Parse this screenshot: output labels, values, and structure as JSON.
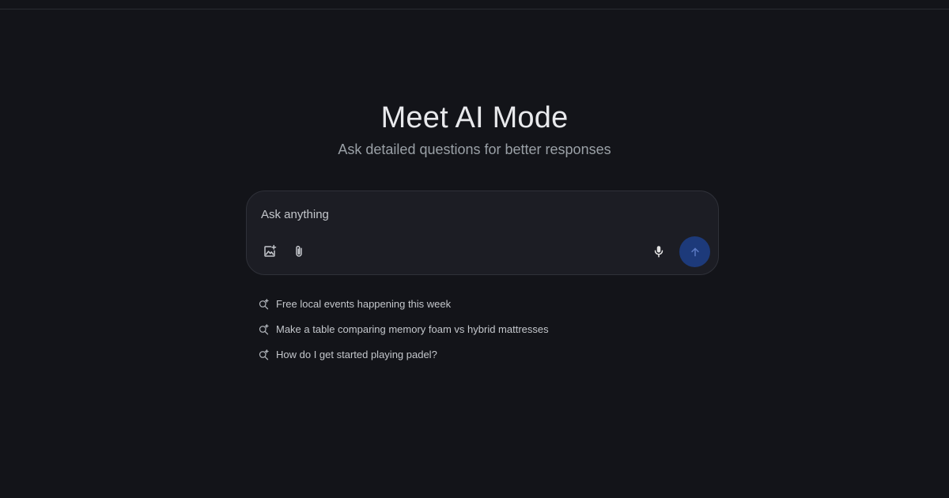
{
  "hero": {
    "title": "Meet AI Mode",
    "subtitle": "Ask detailed questions for better responses"
  },
  "composer": {
    "placeholder": "Ask anything",
    "value": "",
    "buttons": {
      "image": "image-sparkle-icon",
      "attach": "paperclip-icon",
      "mic": "microphone-icon",
      "send": "arrow-up-icon"
    }
  },
  "suggestions": [
    {
      "label": "Free local events happening this week",
      "icon": "search-sparkle-icon"
    },
    {
      "label": "Make a table comparing memory foam vs hybrid mattresses",
      "icon": "search-sparkle-icon"
    },
    {
      "label": "How do I get started playing padel?",
      "icon": "search-sparkle-icon"
    }
  ],
  "colors": {
    "background": "#131419",
    "composer_bg": "#1c1d24",
    "send_button": "#1d3a7a",
    "title": "#e8e9ec",
    "subtitle": "#9aa0a6"
  }
}
